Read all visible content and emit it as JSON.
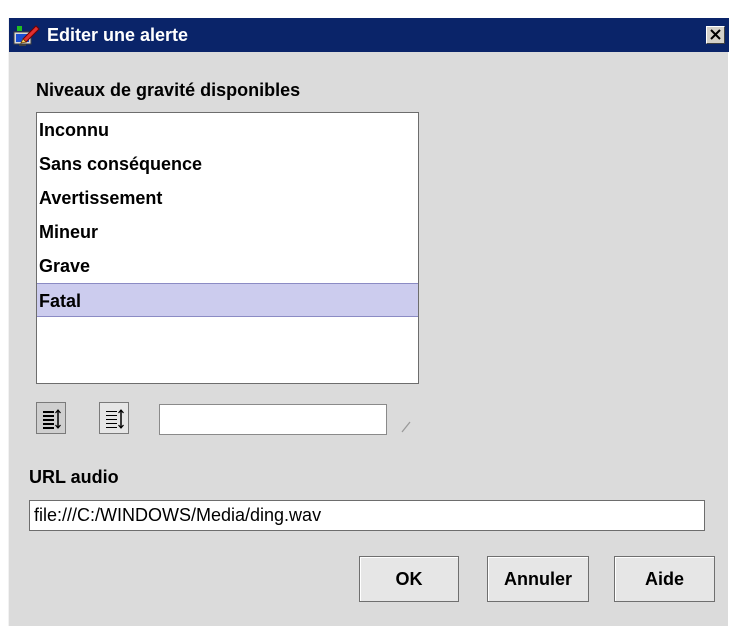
{
  "window": {
    "title": "Editer une alerte",
    "icon": "app-edit-icon",
    "close_icon": "close-icon"
  },
  "severity": {
    "label": "Niveaux de gravité disponibles",
    "items": [
      "Inconnu",
      "Sans conséquence",
      "Avertissement",
      "Mineur",
      "Grave",
      "Fatal"
    ],
    "selected": "Fatal"
  },
  "toolbar": {
    "move_up_icon": "list-align-icon",
    "move_down_icon": "list-reorder-icon",
    "combo_value": ""
  },
  "audio": {
    "label": "URL audio",
    "url": "file:///C:/WINDOWS/Media/ding.wav"
  },
  "buttons": {
    "ok": "OK",
    "cancel": "Annuler",
    "help": "Aide"
  },
  "colors": {
    "titlebar": "#0a2469",
    "dialog_bg": "#dbdbdb",
    "selection": "#ccccee"
  }
}
